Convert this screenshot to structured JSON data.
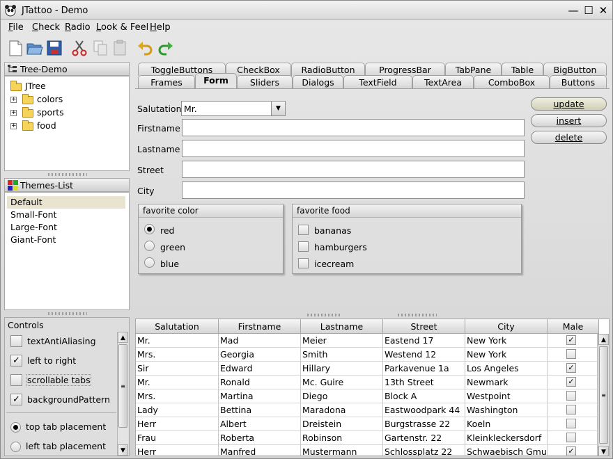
{
  "window": {
    "title": "JTattoo - Demo",
    "minimize_glyph": "—",
    "maximize_glyph": "☐",
    "close_glyph": "✕"
  },
  "menu": {
    "items": [
      {
        "label": "File",
        "mnemonic": "F",
        "rest": "ile"
      },
      {
        "label": "Check",
        "mnemonic": "C",
        "rest": "heck"
      },
      {
        "label": "Radio",
        "mnemonic": "R",
        "rest": "adio"
      },
      {
        "label": "Look & Feel",
        "mnemonic": "L",
        "rest": "ook & Feel"
      },
      {
        "label": "Help",
        "mnemonic": "H",
        "rest": "elp"
      }
    ]
  },
  "toolbar": {
    "icons": [
      "new-file-icon",
      "open-folder-icon",
      "save-icon",
      "cut-icon",
      "copy-icon",
      "paste-icon",
      "undo-icon",
      "redo-icon"
    ]
  },
  "tree_panel": {
    "title": "Tree-Demo",
    "root": "JTree",
    "nodes": [
      "colors",
      "sports",
      "food"
    ],
    "expander": "+"
  },
  "themes_panel": {
    "title": "Themes-List",
    "items": [
      "Default",
      "Small-Font",
      "Large-Font",
      "Giant-Font"
    ],
    "selected": "Default"
  },
  "controls_panel": {
    "title": "Controls",
    "checkboxes": [
      {
        "label": "textAntiAliasing",
        "checked": false
      },
      {
        "label": "left to right",
        "checked": true
      },
      {
        "label": "scrollable tabs",
        "checked": false
      },
      {
        "label": "backgroundPattern",
        "checked": true
      }
    ],
    "radios": [
      {
        "label": "top tab placement",
        "selected": true
      },
      {
        "label": "left tab placement",
        "selected": false
      }
    ]
  },
  "tabs": {
    "row_back": [
      "ToggleButtons",
      "CheckBox",
      "RadioButton",
      "ProgressBar",
      "TabPane",
      "Table",
      "BigButton"
    ],
    "row_front": [
      "Frames",
      "Form",
      "Sliders",
      "Dialogs",
      "TextField",
      "TextArea",
      "ComboBox",
      "Buttons"
    ],
    "active": "Form"
  },
  "form": {
    "salutation_label": "Salutation",
    "salutation_value": "Mr.",
    "combo_arrow": "▼",
    "firstname_label": "Firstname",
    "lastname_label": "Lastname",
    "street_label": "Street",
    "city_label": "City",
    "firstname_value": "",
    "lastname_value": "",
    "street_value": "",
    "city_value": "",
    "buttons": {
      "update": "update",
      "insert": "insert",
      "delete": "delete"
    },
    "favorite_color": {
      "title": "favorite color",
      "options": [
        "red",
        "green",
        "blue"
      ],
      "selected": "red"
    },
    "favorite_food": {
      "title": "favorite food",
      "options": [
        "bananas",
        "hamburgers",
        "icecream"
      ]
    }
  },
  "table": {
    "columns": [
      "Salutation",
      "Firstname",
      "Lastname",
      "Street",
      "City",
      "Male"
    ],
    "rows": [
      [
        "Mr.",
        "Mad",
        "Meier",
        "Eastend 17",
        "New York",
        true
      ],
      [
        "Mrs.",
        "Georgia",
        "Smith",
        "Westend 12",
        "New York",
        false
      ],
      [
        "Sir",
        "Edward",
        "Hillary",
        "Parkavenue 1a",
        "Los Angeles",
        true
      ],
      [
        "Mr.",
        "Ronald",
        "Mc. Guire",
        "13th Street",
        "Newmark",
        true
      ],
      [
        "Mrs.",
        "Martina",
        "Diego",
        "Block A",
        "Westpoint",
        false
      ],
      [
        "Lady",
        "Bettina",
        "Maradona",
        "Eastwoodpark 44",
        "Washington",
        false
      ],
      [
        "Herr",
        "Albert",
        "Dreistein",
        "Burgstrasse 22",
        "Koeln",
        false
      ],
      [
        "Frau",
        "Roberta",
        "Robinson",
        "Gartenstr. 22",
        "Kleinkleckersdorf",
        false
      ],
      [
        "Herr",
        "Manfred",
        "Mustermann",
        "Schlossplatz 22",
        "Schwaebisch Gmu...",
        true
      ]
    ]
  },
  "glyphs": {
    "check": "✓",
    "up": "▲",
    "down": "▼",
    "grip": "≡"
  },
  "colors": {
    "selection": "#e8e4cf",
    "window_bg": "#d8d8d8"
  }
}
